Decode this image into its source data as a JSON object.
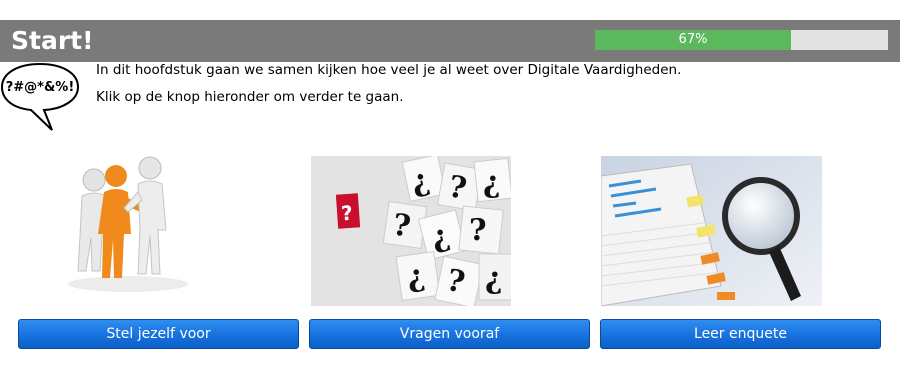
{
  "header": {
    "title": "Start!",
    "progress_label": "67%",
    "progress_fraction": 0.67,
    "colors": {
      "bar_bg": "#7a7a7a",
      "progress_fill": "#5cb85c",
      "progress_track": "#e2e2e2"
    }
  },
  "speech_bubble": {
    "text": "?#@*&%!"
  },
  "intro": {
    "line1": "In dit hoofdstuk gaan we samen kijken hoe veel je al weet over Digitale Vaardigheden.",
    "line2": "Klik op de knop hieronder om verder te gaan."
  },
  "cards": [
    {
      "image": "people-introducing-illustration",
      "button_label": "Stel jezelf voor"
    },
    {
      "image": "question-marks-photo",
      "button_label": "Vragen vooraf"
    },
    {
      "image": "documents-magnifying-glass-photo",
      "button_label": "Leer enquete"
    }
  ],
  "colors": {
    "button": "#1a74e0"
  }
}
